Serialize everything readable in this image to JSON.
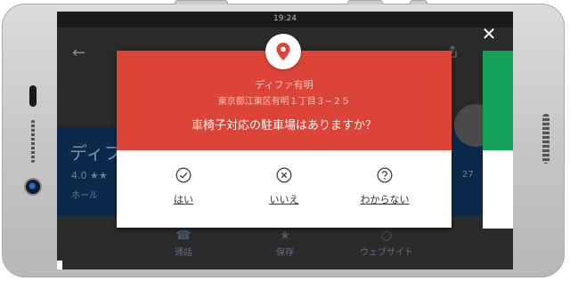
{
  "status_bar": {
    "time": "19:24"
  },
  "background": {
    "place_title": "ディフ",
    "rating": "4.0 ★★",
    "category": "ホール",
    "distance": "27",
    "actions": [
      {
        "icon": "phone-icon",
        "label": "通話"
      },
      {
        "icon": "star-icon",
        "label": "保存"
      },
      {
        "icon": "globe-icon",
        "label": "ウェブサイト"
      }
    ]
  },
  "dialog": {
    "place_name": "ディファ有明",
    "address": "東京都江東区有明１丁目３−２５",
    "question": "車椅子対応の駐車場はありますか？",
    "answers": [
      {
        "icon": "check-circle-icon",
        "label": "はい"
      },
      {
        "icon": "x-circle-icon",
        "label": "いいえ"
      },
      {
        "icon": "question-circle-icon",
        "label": "わからない"
      }
    ]
  },
  "colors": {
    "header_red": "#db4437",
    "side_card_green": "#16a15a"
  }
}
